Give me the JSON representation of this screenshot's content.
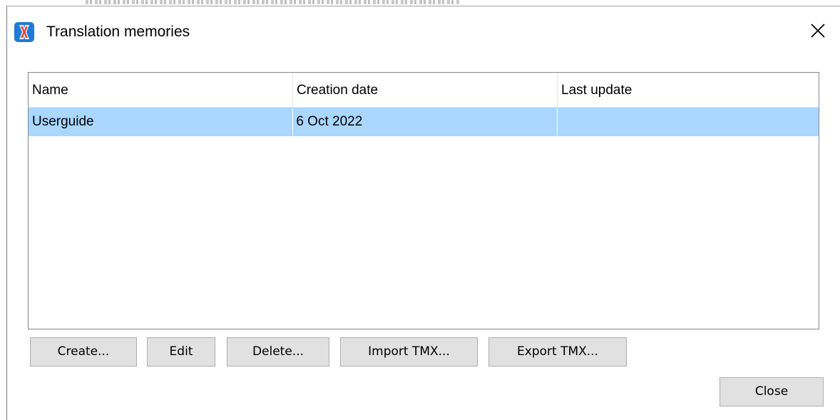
{
  "window": {
    "title": "Translation memories",
    "icon": "app-logo-icon",
    "close_icon": "close-icon"
  },
  "list": {
    "columns": [
      "Name",
      "Creation date",
      "Last update"
    ],
    "rows": [
      {
        "name": "Userguide",
        "creation_date": "6 Oct 2022",
        "last_update": "",
        "selected": true
      }
    ]
  },
  "buttons": {
    "create": "Create...",
    "edit": "Edit",
    "delete": "Delete...",
    "import_tmx": "Import TMX...",
    "export_tmx": "Export TMX...",
    "close": "Close"
  },
  "colors": {
    "selection": "#a9d7ff",
    "button_bg": "#e1e1e1",
    "button_border": "#adadad",
    "logo_blue": "#1e7bd6",
    "logo_red": "#e23b2e"
  }
}
